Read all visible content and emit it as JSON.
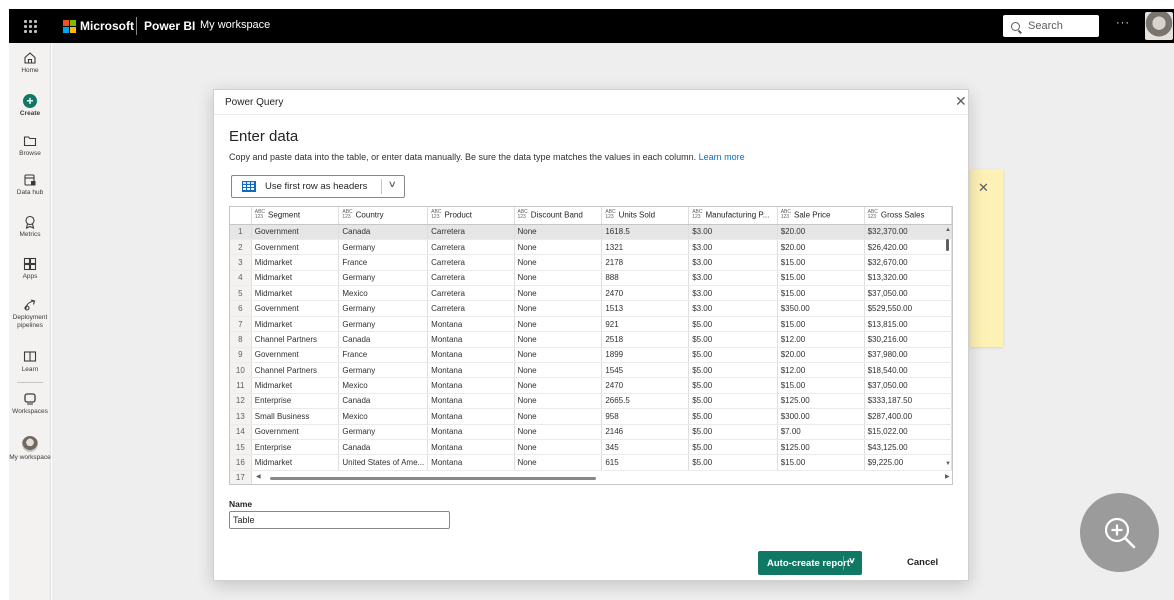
{
  "topbar": {
    "brand": "Microsoft",
    "product": "Power BI",
    "workspace": "My workspace",
    "search_placeholder": "Search",
    "more": "···"
  },
  "nav": {
    "items": [
      {
        "label": "Home",
        "icon": "home-icon"
      },
      {
        "label": "Create",
        "icon": "create-icon"
      },
      {
        "label": "Browse",
        "icon": "folder-icon"
      },
      {
        "label": "Data hub",
        "icon": "data-hub-icon"
      },
      {
        "label": "Metrics",
        "icon": "metrics-icon"
      },
      {
        "label": "Apps",
        "icon": "apps-icon"
      },
      {
        "label": "Deployment pipelines",
        "icon": "pipeline-icon"
      },
      {
        "label": "Learn",
        "icon": "learn-icon"
      },
      {
        "label": "Workspaces",
        "icon": "workspaces-icon"
      },
      {
        "label": "My workspace",
        "icon": "avatar"
      }
    ]
  },
  "dialog": {
    "title": "Power Query",
    "heading": "Enter data",
    "description": "Copy and paste data into the table, or enter data manually. Be sure the data type matches the values in each column.",
    "learn_more": "Learn more",
    "header_toggle": "Use first row as headers",
    "type_label_top": "ABC",
    "type_label_bottom": "123",
    "columns": [
      "Segment",
      "Country",
      "Product",
      "Discount Band",
      "Units Sold",
      "Manufacturing P...",
      "Sale Price",
      "Gross Sales"
    ],
    "rows": [
      [
        "1",
        "Government",
        "Canada",
        "Carretera",
        "None",
        "1618.5",
        "$3.00",
        "$20.00",
        "$32,370.00"
      ],
      [
        "2",
        "Government",
        "Germany",
        "Carretera",
        "None",
        "1321",
        "$3.00",
        "$20.00",
        "$26,420.00"
      ],
      [
        "3",
        "Midmarket",
        "France",
        "Carretera",
        "None",
        "2178",
        "$3.00",
        "$15.00",
        "$32,670.00"
      ],
      [
        "4",
        "Midmarket",
        "Germany",
        "Carretera",
        "None",
        "888",
        "$3.00",
        "$15.00",
        "$13,320.00"
      ],
      [
        "5",
        "Midmarket",
        "Mexico",
        "Carretera",
        "None",
        "2470",
        "$3.00",
        "$15.00",
        "$37,050.00"
      ],
      [
        "6",
        "Government",
        "Germany",
        "Carretera",
        "None",
        "1513",
        "$3.00",
        "$350.00",
        "$529,550.00"
      ],
      [
        "7",
        "Midmarket",
        "Germany",
        "Montana",
        "None",
        "921",
        "$5.00",
        "$15.00",
        "$13,815.00"
      ],
      [
        "8",
        "Channel Partners",
        "Canada",
        "Montana",
        "None",
        "2518",
        "$5.00",
        "$12.00",
        "$30,216.00"
      ],
      [
        "9",
        "Government",
        "France",
        "Montana",
        "None",
        "1899",
        "$5.00",
        "$20.00",
        "$37,980.00"
      ],
      [
        "10",
        "Channel Partners",
        "Germany",
        "Montana",
        "None",
        "1545",
        "$5.00",
        "$12.00",
        "$18,540.00"
      ],
      [
        "11",
        "Midmarket",
        "Mexico",
        "Montana",
        "None",
        "2470",
        "$5.00",
        "$15.00",
        "$37,050.00"
      ],
      [
        "12",
        "Enterprise",
        "Canada",
        "Montana",
        "None",
        "2665.5",
        "$5.00",
        "$125.00",
        "$333,187.50"
      ],
      [
        "13",
        "Small Business",
        "Mexico",
        "Montana",
        "None",
        "958",
        "$5.00",
        "$300.00",
        "$287,400.00"
      ],
      [
        "14",
        "Government",
        "Germany",
        "Montana",
        "None",
        "2146",
        "$5.00",
        "$7.00",
        "$15,022.00"
      ],
      [
        "15",
        "Enterprise",
        "Canada",
        "Montana",
        "None",
        "345",
        "$5.00",
        "$125.00",
        "$43,125.00"
      ],
      [
        "16",
        "Midmarket",
        "United States of Ame...",
        "Montana",
        "None",
        "615",
        "$5.00",
        "$15.00",
        "$9,225.00"
      ],
      [
        "17",
        "",
        "",
        "",
        "",
        "",
        "",
        "",
        ""
      ]
    ],
    "name_label": "Name",
    "name_value": "Table",
    "primary_button": "Auto-create report",
    "cancel_button": "Cancel"
  },
  "colors": {
    "accent": "#117865",
    "link": "#0f6cbd",
    "topbar": "#000000"
  }
}
